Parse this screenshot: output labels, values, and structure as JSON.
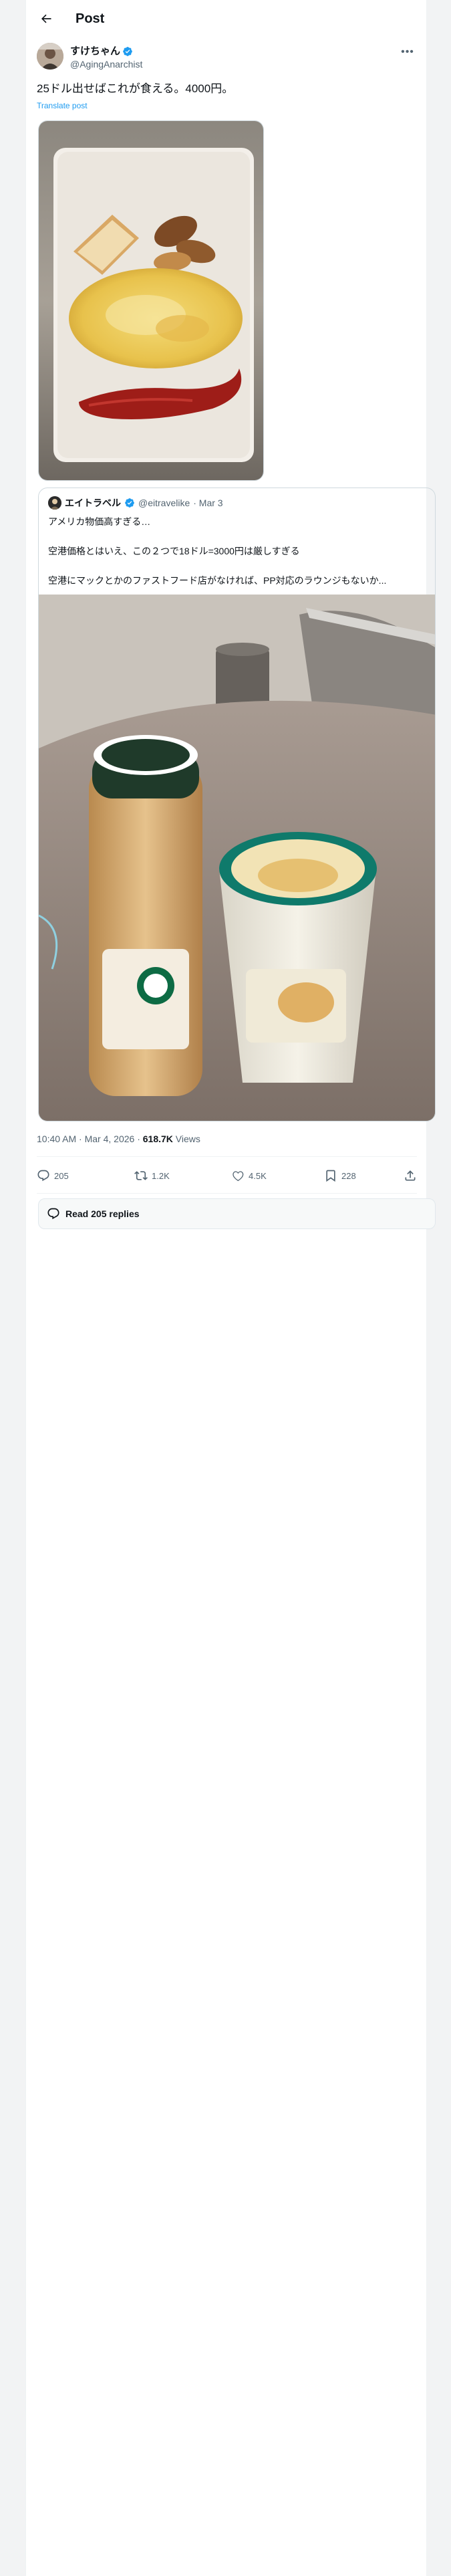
{
  "header": {
    "title": "Post",
    "back_icon": "arrow-left-icon"
  },
  "author": {
    "display_name": "すけちゃん",
    "handle": "@AgingAnarchist",
    "verified": true,
    "more_icon": "more-horizontal-icon"
  },
  "tweet": {
    "text": "25ドル出せばこれが食える。4000円。",
    "translate_label": "Translate post",
    "media_description_icon": "food-photo"
  },
  "quote": {
    "display_name": "エイトラベル",
    "handle": "@eitravelike",
    "date": "· Mar 3",
    "lines": [
      "アメリカ物価高すぎる…",
      "空港価格とはいえ、この２つで18ドル=3000円は厳しすぎる",
      "空港にマックとかのファストフード店がなければ、PP対応のラウンジもないか..."
    ]
  },
  "meta": {
    "timestamp": "10:40 AM · Mar 4, 2026 · ",
    "views_count": "618.7K",
    "views_label": " Views"
  },
  "actions": {
    "replies": "205",
    "reposts": "1.2K",
    "likes": "4.5K",
    "bookmarks": "228"
  },
  "read_replies": {
    "label": "Read 205 replies"
  },
  "colors": {
    "accent": "#1d9bf0",
    "text": "#0f1419",
    "secondary": "#536471",
    "border": "#cfd9de"
  }
}
